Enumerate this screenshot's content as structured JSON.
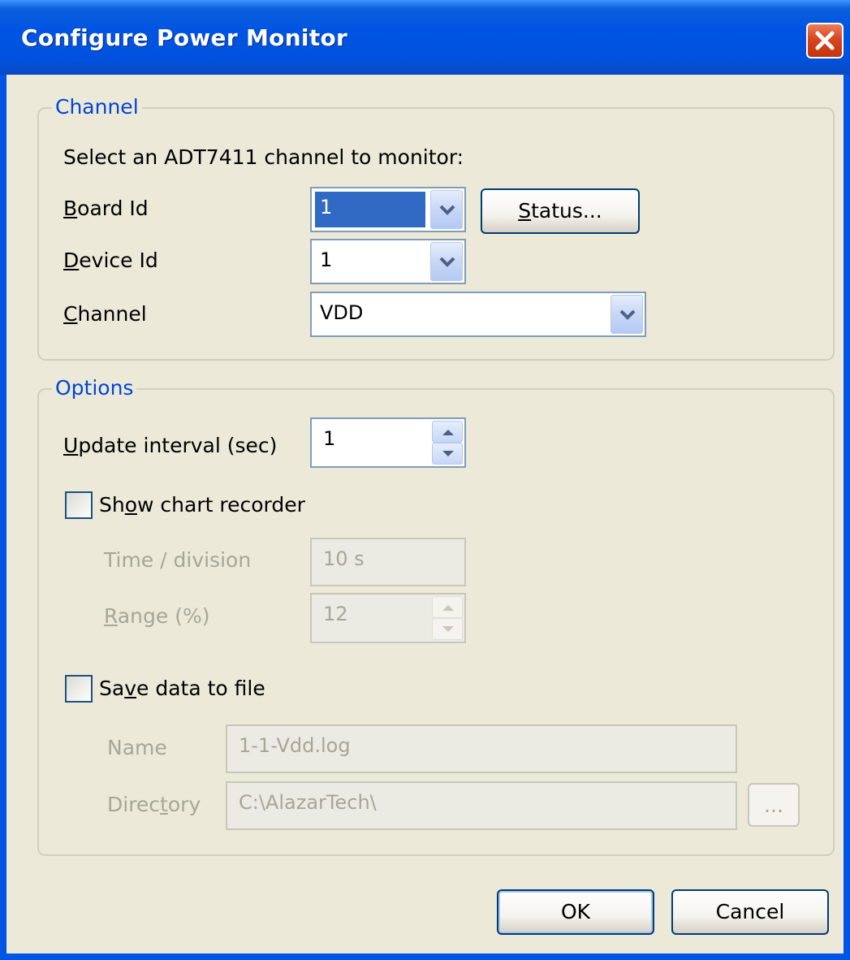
{
  "window": {
    "title": "Configure Power Monitor"
  },
  "channel_group": {
    "legend": "Channel",
    "instruction": "Select an ADT7411 channel to monitor:",
    "board_id": {
      "label_mn": "B",
      "label_rest": "oard Id",
      "value": "1"
    },
    "status_button": {
      "label_mn": "S",
      "label_rest": "tatus..."
    },
    "device_id": {
      "label_mn": "D",
      "label_rest": "evice Id",
      "value": "1"
    },
    "channel": {
      "label_mn": "C",
      "label_rest": "hannel",
      "value": "VDD"
    }
  },
  "options_group": {
    "legend": "Options",
    "update_interval": {
      "label_mn": "U",
      "label_rest": "pdate interval (sec)",
      "value": "1"
    },
    "show_chart": {
      "label_pre": "Sh",
      "label_mn": "o",
      "label_rest": "w chart recorder",
      "checked": false
    },
    "time_division": {
      "label": "Time / division",
      "value": "10 s"
    },
    "range": {
      "label_mn": "R",
      "label_rest": "ange (%)",
      "value": "12"
    },
    "save_data": {
      "label_pre": "Sa",
      "label_mn": "v",
      "label_rest": "e data to file",
      "checked": false
    },
    "name": {
      "label": "Name",
      "value": "1-1-Vdd.log"
    },
    "directory": {
      "label_pre": "Direc",
      "label_mn": "t",
      "label_rest": "ory",
      "value": "C:\\AlazarTech\\"
    },
    "browse_button": {
      "label": "..."
    }
  },
  "buttons": {
    "ok": "OK",
    "cancel": "Cancel"
  },
  "colors": {
    "titlebar": "#0054e3",
    "client": "#ece9d8",
    "legend": "#0046d5",
    "selection": "#316ac5"
  }
}
